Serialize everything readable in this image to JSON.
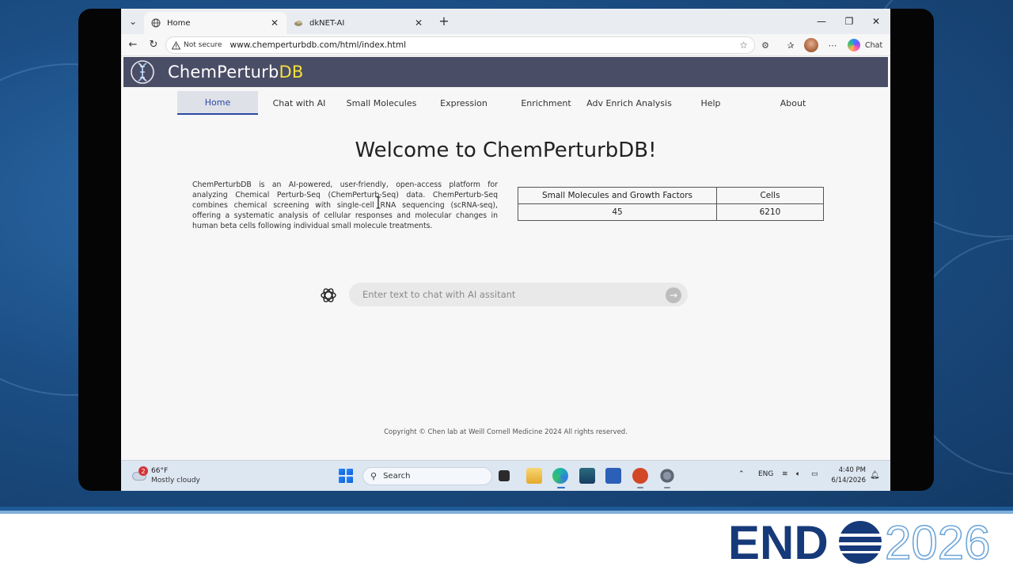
{
  "browser": {
    "tabs": [
      {
        "title": "Home",
        "active": true
      },
      {
        "title": "dkNET-AI",
        "active": false
      }
    ],
    "security_label": "Not secure",
    "url": "www.chemperturbdb.com/html/index.html",
    "copilot_label": "Chat"
  },
  "site": {
    "title_main": "ChemPerturb",
    "title_accent": "DB",
    "nav": [
      {
        "label": "Home",
        "active": true
      },
      {
        "label": "Chat with AI"
      },
      {
        "label": "Small Molecules"
      },
      {
        "label": "Expression"
      },
      {
        "label": "Enrichment"
      },
      {
        "label": "Adv Enrich Analysis"
      },
      {
        "label": "Help"
      },
      {
        "label": "About"
      }
    ],
    "welcome_heading": "Welcome to ChemPerturbDB!",
    "intro_text": "ChemPerturbDB is an AI-powered, user-friendly, open-access platform for analyzing Chemical Perturb-Seq (ChemPerturb-Seq) data. ChemPerturb-Seq combines chemical screening with single-cell RNA sequencing (scRNA-seq), offering a systematic analysis of cellular responses and molecular changes in human beta cells following individual small molecule treatments.",
    "stats_table": {
      "headers": [
        "Small Molecules and Growth Factors",
        "Cells"
      ],
      "values": [
        "45",
        "6210"
      ]
    },
    "chat": {
      "placeholder": "Enter text to chat with AI assitant",
      "value": ""
    },
    "copyright": "Copyright © Chen lab at Weill Cornell Medicine 2024 All rights reserved."
  },
  "taskbar": {
    "weather_temp": "66°F",
    "weather_condition": "Mostly cloudy",
    "weather_badge": "2",
    "search_label": "Search",
    "language": "ENG",
    "time": "4:40 PM",
    "date": "6/14/2026"
  },
  "slide": {
    "logo_text_left": "END",
    "logo_text_right": "2026"
  },
  "colors": {
    "site_header": "#4a4d66",
    "title_accent": "#f5e03a",
    "nav_active": "#2b49a5",
    "endo_navy": "#16397a",
    "endo_light": "#6fa7d9"
  }
}
